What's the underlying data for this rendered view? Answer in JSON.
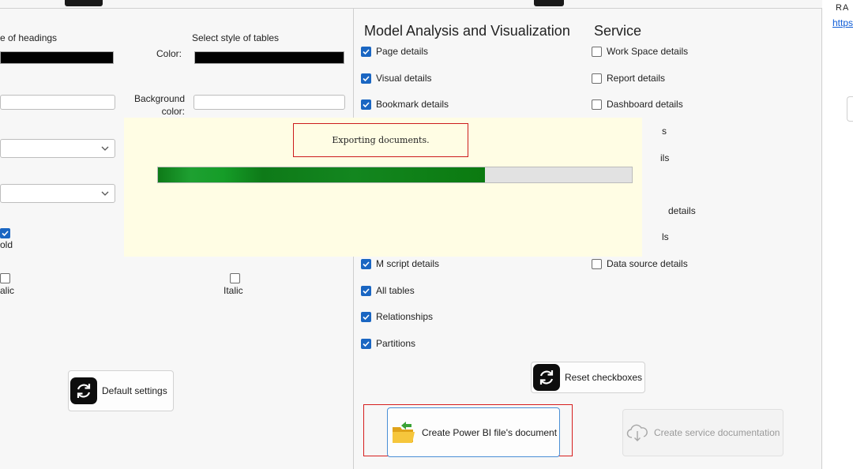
{
  "left_panel": {
    "headings_label": "e of headings",
    "tables_label": "Select style of tables",
    "color_label": "Color:",
    "background_label_line1": "Background",
    "background_label_line2": "color:",
    "bold_label": "old",
    "italic_left_label": "alic",
    "italic_right_label": "Italic",
    "bold_checked": true,
    "italic_left_checked": false,
    "italic_right_checked": false,
    "swatch_color": "#000000",
    "default_button_label": "Default settings",
    "default_button_icon": "refresh-icon"
  },
  "mid_panel": {
    "model_title": "Model Analysis and Visualization",
    "service_title": "Service",
    "model_checks": [
      {
        "label": "Page details",
        "checked": true
      },
      {
        "label": "Visual details",
        "checked": true
      },
      {
        "label": "Bookmark details",
        "checked": true
      },
      {
        "label": "M script details",
        "checked": true
      },
      {
        "label": "All tables",
        "checked": true
      },
      {
        "label": "Relationships",
        "checked": true
      },
      {
        "label": "Partitions",
        "checked": true
      }
    ],
    "service_checks": [
      {
        "label": "Work Space details",
        "checked": false
      },
      {
        "label": "Report details",
        "checked": false
      },
      {
        "label": "Dashboard details",
        "checked": false
      },
      {
        "label": "Data source details",
        "checked": false
      }
    ],
    "service_partial": {
      "line4": "s",
      "line5": "ils",
      "line8": "details",
      "line9": "ls"
    },
    "reset_button_label": "Reset checkboxes",
    "create_pbi_label": "Create Power BI file's document",
    "create_service_label": "Create service documentation",
    "create_pbi_icon": "folder-open-icon",
    "create_service_icon": "cloud-download-icon"
  },
  "right_panel": {
    "partial_text": "RA",
    "partial_link": "https"
  },
  "overlay": {
    "status_text": "Exporting documents.",
    "progress_fraction": 0.69,
    "progress_color": "#0e7a18",
    "status_border_color": "#cc1c1c"
  },
  "colors": {
    "checkbox_accent": "#1a66c2",
    "highlight_red": "#d61e1e",
    "overlay_bg": "#fffde4"
  }
}
